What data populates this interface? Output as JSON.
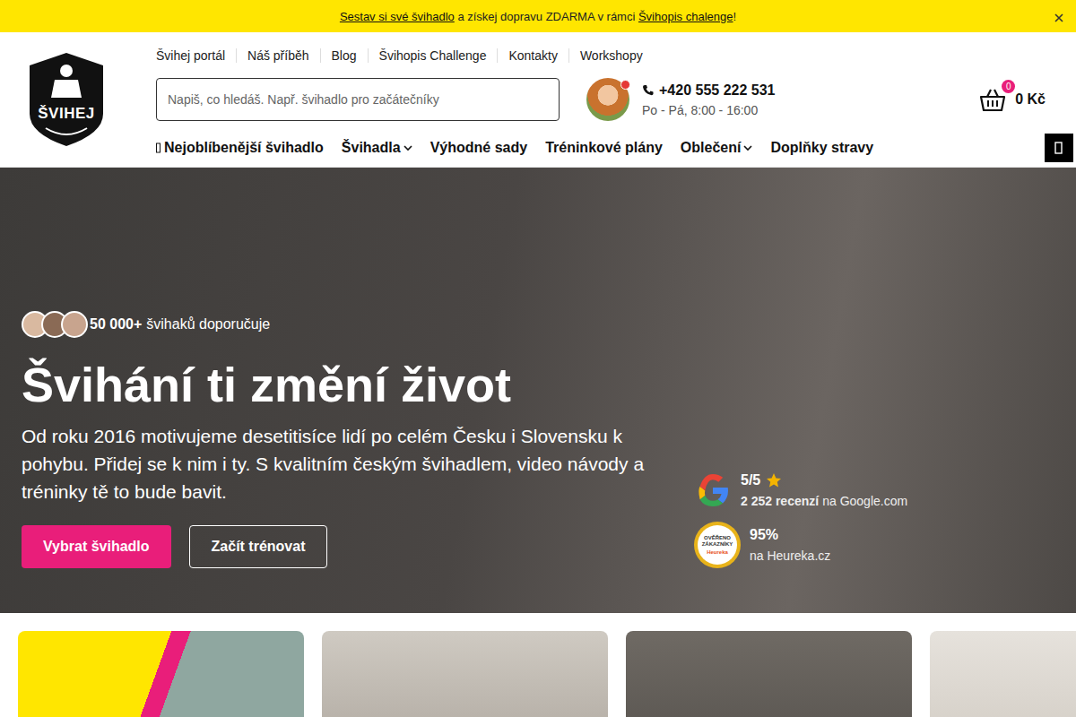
{
  "promo_bar": {
    "parts": [
      {
        "text": "Sestav si své švihadlo",
        "link": true
      },
      {
        "text": " a získej dopravu ZDARMA v rámci ",
        "link": false
      },
      {
        "text": "Švihopis chalenge",
        "link": true
      },
      {
        "text": "!",
        "link": false
      }
    ]
  },
  "logo": {
    "text": "ŠVIHEJ"
  },
  "top_links": [
    "Švihej portál",
    "Náš příběh",
    "Blog",
    "Švihopis Challenge",
    "Kontakty",
    "Workshopy"
  ],
  "search": {
    "placeholder": "Napiš, co hledáš. Např. švihadlo pro začátečníky"
  },
  "contact": {
    "phone": "+420 555 222 531",
    "hours": "Po - Pá, 8:00 - 16:00",
    "online": true
  },
  "cart": {
    "count": "0",
    "total": "0 Kč"
  },
  "nav": [
    {
      "label": "Nejoblíbenější švihadlo",
      "has_menu": false
    },
    {
      "label": "Švihadla",
      "has_menu": true
    },
    {
      "label": "Výhodné sady",
      "has_menu": false
    },
    {
      "label": "Tréninkové plány",
      "has_menu": false
    },
    {
      "label": "Oblečení",
      "has_menu": true
    },
    {
      "label": "Doplňky stravy",
      "has_menu": false
    }
  ],
  "hero": {
    "social_proof": {
      "count": "50 000+",
      "text": "švihaků doporučuje"
    },
    "title": "Švihání ti změní život",
    "text": "Od roku 2016 motivujeme desetitisíce lidí po celém Česku i Slovensku k pohybu. Přidej se k nim i ty. S kvalitním českým švihadlem, video návody a tréninky tě to bude bavit.",
    "buttons": [
      {
        "label": "Vybrat švihadlo",
        "kind": "primary"
      },
      {
        "label": "Začít trénovat",
        "kind": "outline"
      }
    ],
    "ratings": [
      {
        "kind": "google",
        "score": "5/5",
        "bold": "2 252 recenzí",
        "rest": "na Google.com"
      },
      {
        "kind": "heureka",
        "score": "95%",
        "bold": "",
        "rest": "na Heureka.cz",
        "badge": [
          "OVĚŘENO",
          "ZÁKAZNÍKY",
          "Heureka"
        ]
      }
    ]
  }
}
